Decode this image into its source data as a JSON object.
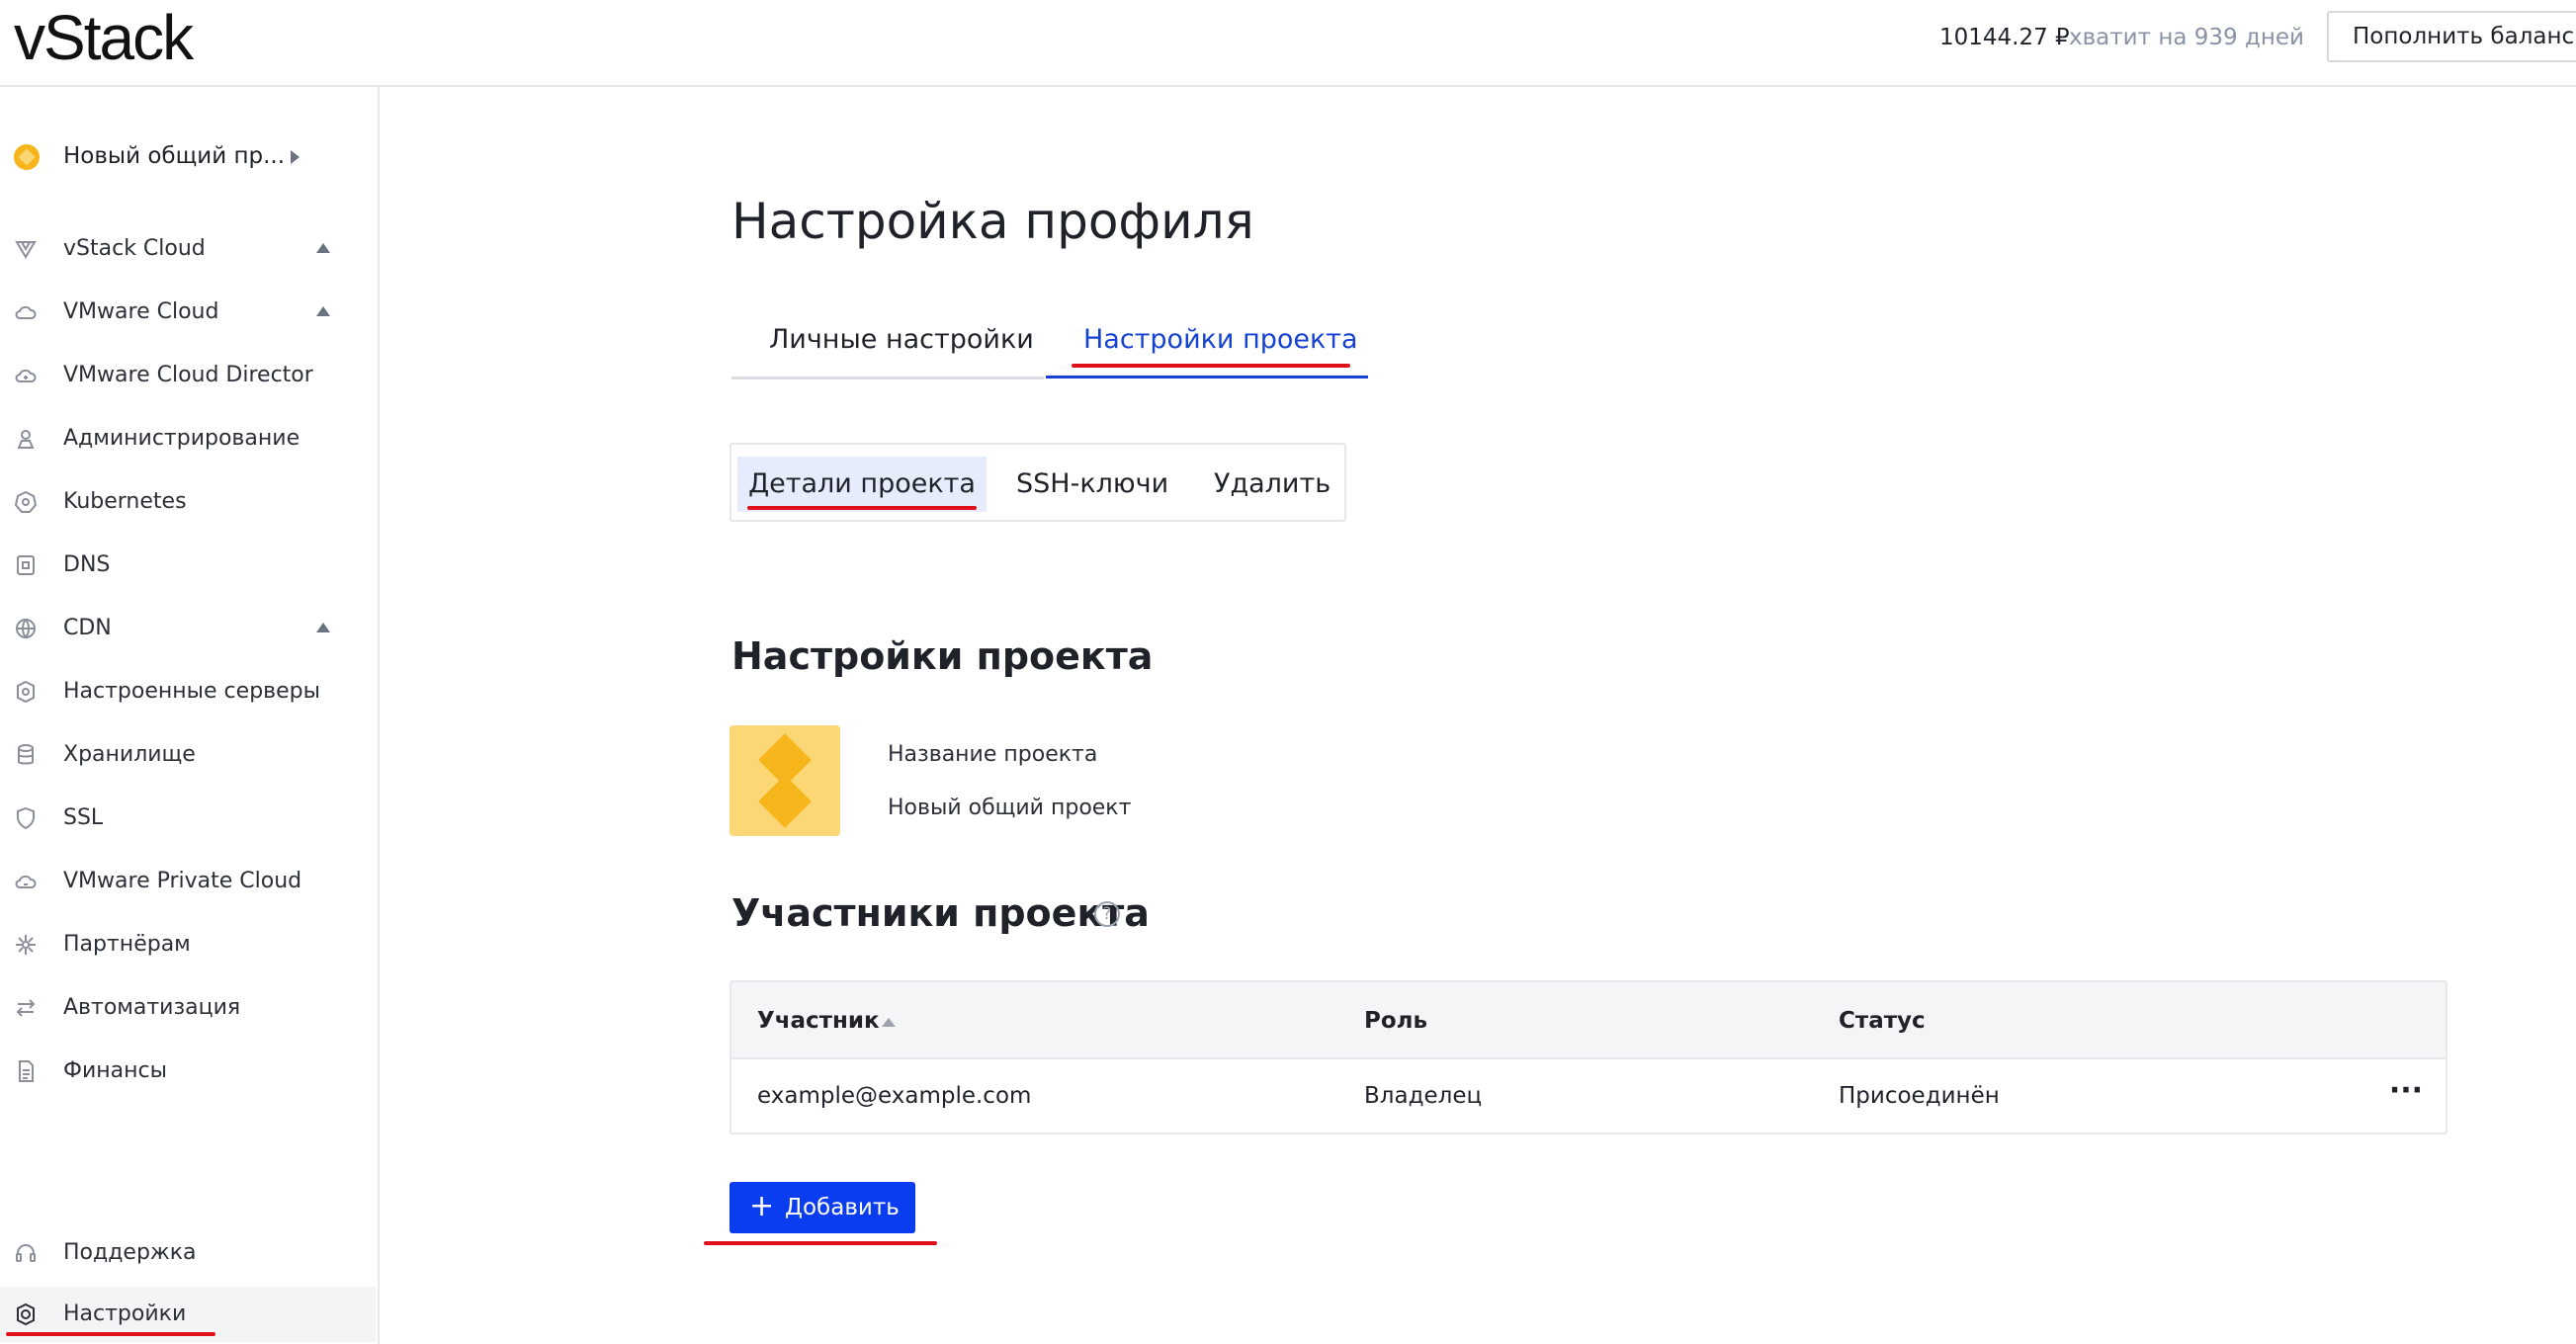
{
  "header": {
    "logo": "vStack",
    "balance": "10144.27 ₽",
    "days_left": "хватит на 939 дней",
    "topup_button": "Пополнить баланс"
  },
  "sidebar": {
    "project_selector": "Новый общий пр...",
    "items": [
      {
        "label": "vStack Cloud",
        "icon": "vstack-icon",
        "expandable": true
      },
      {
        "label": "VMware Cloud",
        "icon": "cloud-icon",
        "expandable": true
      },
      {
        "label": "VMware Cloud Director",
        "icon": "cloud-director-icon",
        "expandable": false
      },
      {
        "label": "Администрирование",
        "icon": "admin-icon",
        "expandable": false
      },
      {
        "label": "Kubernetes",
        "icon": "kubernetes-icon",
        "expandable": false
      },
      {
        "label": "DNS",
        "icon": "dns-icon",
        "expandable": false
      },
      {
        "label": "CDN",
        "icon": "globe-icon",
        "expandable": true
      },
      {
        "label": "Настроенные серверы",
        "icon": "gear-server-icon",
        "expandable": false
      },
      {
        "label": "Хранилище",
        "icon": "database-icon",
        "expandable": false
      },
      {
        "label": "SSL",
        "icon": "shield-icon",
        "expandable": false
      },
      {
        "label": "VMware Private Cloud",
        "icon": "private-cloud-icon",
        "expandable": false
      },
      {
        "label": "Партнёрам",
        "icon": "partners-icon",
        "expandable": false
      },
      {
        "label": "Автоматизация",
        "icon": "arrows-icon",
        "expandable": false
      },
      {
        "label": "Финансы",
        "icon": "document-icon",
        "expandable": false
      }
    ],
    "support": "Поддержка",
    "settings": "Настройки"
  },
  "main": {
    "title": "Настройка профиля",
    "tabs": [
      {
        "label": "Личные настройки",
        "active": false
      },
      {
        "label": "Настройки проекта",
        "active": true
      }
    ],
    "subtabs": [
      {
        "label": "Детали проекта",
        "active": true
      },
      {
        "label": "SSH-ключи",
        "active": false
      },
      {
        "label": "Удалить",
        "active": false
      }
    ],
    "project_section_title": "Настройки проекта",
    "project_name_label": "Название проекта",
    "project_name_value": "Новый общий проект",
    "members_title": "Участники проекта",
    "help_symbol": "?",
    "table": {
      "columns": [
        "Участник",
        "Роль",
        "Статус"
      ],
      "rows": [
        {
          "member": "example@example.com",
          "role": "Владелец",
          "status": "Присоединён"
        }
      ]
    },
    "add_button": "Добавить"
  },
  "colors": {
    "accent": "#0b3df0",
    "tab_active": "#1642d1",
    "annotation_red": "#e0101c",
    "project_avatar": "#fcd775"
  }
}
